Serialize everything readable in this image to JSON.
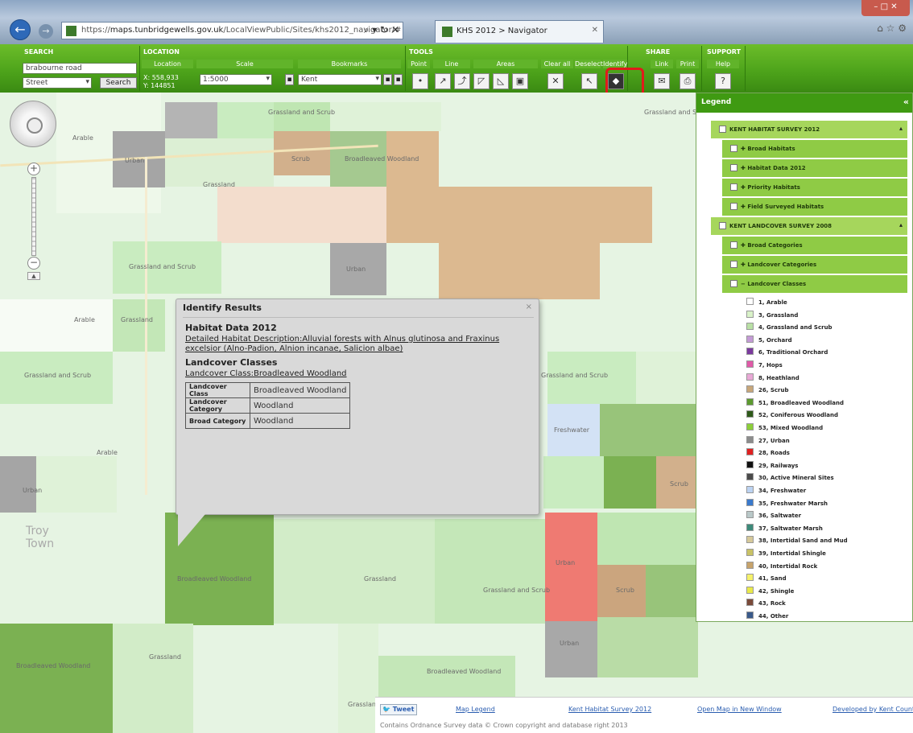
{
  "browser": {
    "url_prefix": "https://",
    "url_host": "maps.tunbridgewells.gov.uk",
    "url_path": "/LocalViewPublic/Sites/khs2012_navigator/#",
    "url_controls": "⌕ ▾ ↻ ✕",
    "tab_title": "KHS 2012 > Navigator",
    "tab_close": "✕",
    "window_controls": "– □ ✕",
    "right_icons": "⌂ ☆ ⚙"
  },
  "toolbar": {
    "search": {
      "header": "SEARCH",
      "value": "brabourne road",
      "type_value": "Street",
      "button": "Search"
    },
    "location": {
      "header": "LOCATION",
      "sub": "Location",
      "x": "X: 558,933",
      "y": "Y: 144851"
    },
    "scale": {
      "sub": "Scale",
      "value": "1:5000"
    },
    "bookmarks": {
      "sub": "Bookmarks",
      "value": "Kent"
    },
    "tools": {
      "header": "TOOLS",
      "subs": [
        "Point",
        "Line",
        "Areas",
        "Clear all",
        "Deselect",
        "Identify"
      ]
    },
    "share": {
      "header": "SHARE",
      "subs": [
        "Link",
        "Print"
      ]
    },
    "support": {
      "header": "SUPPORT",
      "sub": "Help",
      "help_glyph": "?"
    }
  },
  "map_labels": [
    "Grassland and Scrub",
    "Grassland and Scrub",
    "Arable",
    "Urban",
    "Grassland",
    "Scrub",
    "Broadleaved Woodland",
    "Urban",
    "Grassland and Scrub",
    "Urban",
    "Grassland",
    "Arable",
    "Grassland and Scrub",
    "Grassland and Scrub",
    "Arable",
    "Urban",
    "Freshwater",
    "Scrub",
    "Troy Town",
    "Broadleaved Woodland",
    "Grassland",
    "Grassland and Scrub",
    "Scrub",
    "Grassland",
    "Broadleaved Woodland",
    "Grassland",
    "Urban",
    "Broadleaved Woodland"
  ],
  "nav": {
    "zoom_in": "+",
    "zoom_out": "−",
    "collapse": "▲"
  },
  "legend": {
    "title": "Legend",
    "collapse": "«",
    "groups": [
      {
        "label": "KENT HABITAT SURVEY 2012",
        "expander": "▴"
      },
      {
        "label": "Broad Habitats"
      },
      {
        "label": "Habitat Data 2012"
      },
      {
        "label": "Priority Habitats"
      },
      {
        "label": "Field Surveyed Habitats"
      },
      {
        "label": "KENT LANDCOVER SURVEY 2008",
        "expander": "▴"
      },
      {
        "label": "Broad Categories"
      },
      {
        "label": "Landcover Categories"
      },
      {
        "label": "Landcover Classes"
      }
    ],
    "items": [
      {
        "label": "1, Arable",
        "color": "#ffffff"
      },
      {
        "label": "3, Grassland",
        "color": "#d9f2c8"
      },
      {
        "label": "4, Grassland and Scrub",
        "color": "#b9e0a5"
      },
      {
        "label": "5, Orchard",
        "color": "#c49bd6"
      },
      {
        "label": "6, Traditional Orchard",
        "color": "#7b3a9e"
      },
      {
        "label": "7, Hops",
        "color": "#e05aa8"
      },
      {
        "label": "8, Heathland",
        "color": "#e9a9d6"
      },
      {
        "label": "26, Scrub",
        "color": "#c8a77a"
      },
      {
        "label": "51, Broadleaved Woodland",
        "color": "#5c9a2f"
      },
      {
        "label": "52, Coniferous Woodland",
        "color": "#2f5a1a"
      },
      {
        "label": "53, Mixed Woodland",
        "color": "#8ccf3a"
      },
      {
        "label": "27, Urban",
        "color": "#8c8c8c"
      },
      {
        "label": "28, Roads",
        "color": "#e02020"
      },
      {
        "label": "29, Railways",
        "color": "#111111"
      },
      {
        "label": "30, Active Mineral Sites",
        "color": "#4a4a4a"
      },
      {
        "label": "34, Freshwater",
        "color": "#bcd3f2"
      },
      {
        "label": "35, Freshwater Marsh",
        "color": "#3a7acc"
      },
      {
        "label": "36, Saltwater",
        "color": "#b9c8c8"
      },
      {
        "label": "37, Saltwater Marsh",
        "color": "#3d8a7a"
      },
      {
        "label": "38, Intertidal Sand and Mud",
        "color": "#d6c99a"
      },
      {
        "label": "39, Intertidal Shingle",
        "color": "#c9c266"
      },
      {
        "label": "40, Intertidal Rock",
        "color": "#c7a36b"
      },
      {
        "label": "41, Sand",
        "color": "#f5f16b"
      },
      {
        "label": "42, Shingle",
        "color": "#e9e94a"
      },
      {
        "label": "43, Rock",
        "color": "#7a4a3a"
      },
      {
        "label": "44, Other",
        "color": "#3a5a8a"
      }
    ]
  },
  "popup": {
    "title": "Identify Results",
    "close": "×",
    "section1_title": "Habitat Data 2012",
    "section1_link": "Detailed Habitat Description:Alluvial forests with Alnus glutinosa and Fraxinus excelsior (Alno-Padion, Alnion incanae, Salicion albae)",
    "section2_title": "Landcover Classes",
    "section2_link": "Landcover Class:Broadleaved Woodland",
    "rows": [
      {
        "key": "Landcover Class",
        "value": "Broadleaved Woodland"
      },
      {
        "key": "Landcover Category",
        "value": "Woodland"
      },
      {
        "key": "Broad Category",
        "value": "Woodland"
      }
    ]
  },
  "footer": {
    "tweet": "Tweet",
    "links": [
      "Map Legend",
      "Kent Habitat Survey 2012",
      "Open Map in New Window",
      "Developed by Kent County Council"
    ],
    "copyright": "Contains Ordnance Survey data © Crown copyright and database right 2013"
  }
}
